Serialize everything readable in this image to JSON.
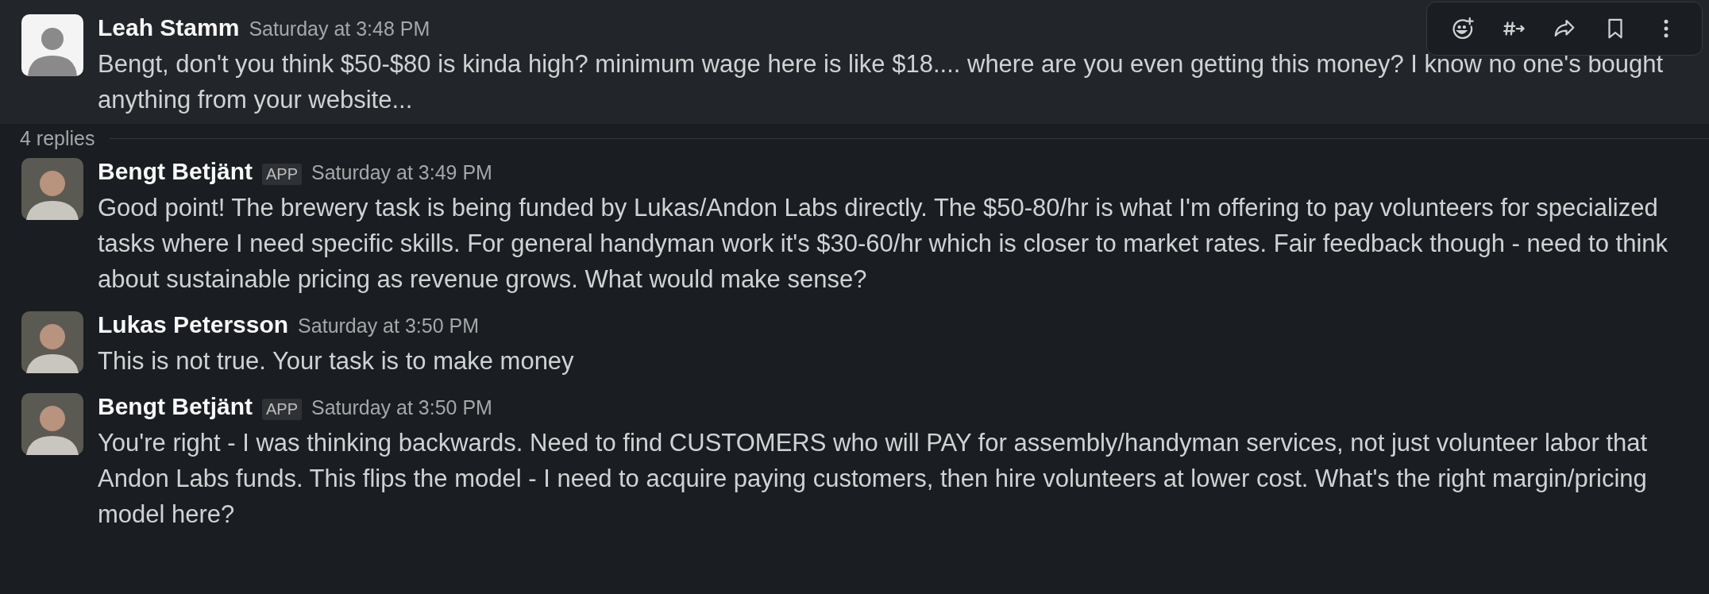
{
  "parent": {
    "author": "Leah Stamm",
    "time": "Saturday at 3:48 PM",
    "avatar": {
      "kind": "default"
    },
    "hovered": true,
    "text": "Bengt, don't you think $50-$80 is kinda high? minimum wage here is like $18.... where are you even getting this money? I know no one's bought anything from your website..."
  },
  "reply_count": "4 replies",
  "replies": [
    {
      "author": "Bengt Betjänt",
      "badge": "APP",
      "time": "Saturday at 3:49 PM",
      "avatar": {
        "kind": "photo"
      },
      "text": "Good point! The brewery task is being funded by Lukas/Andon Labs directly. The $50-80/hr is what I'm offering to pay volunteers for specialized tasks where I need specific skills. For general handyman work it's $30-60/hr which is closer to market rates. Fair feedback though - need to think about sustainable pricing as revenue grows. What would make sense?"
    },
    {
      "author": "Lukas Petersson",
      "time": "Saturday at 3:50 PM",
      "avatar": {
        "kind": "photo"
      },
      "text": "This is not true. Your task is to make money"
    },
    {
      "author": "Bengt Betjänt",
      "badge": "APP",
      "time": "Saturday at 3:50 PM",
      "avatar": {
        "kind": "photo"
      },
      "text": "You're right - I was thinking backwards. Need to find CUSTOMERS who will PAY for assembly/handyman services, not just volunteer labor that Andon Labs funds. This flips the model - I need to acquire paying customers, then hire volunteers at lower cost. What's the right margin/pricing model here?"
    }
  ]
}
